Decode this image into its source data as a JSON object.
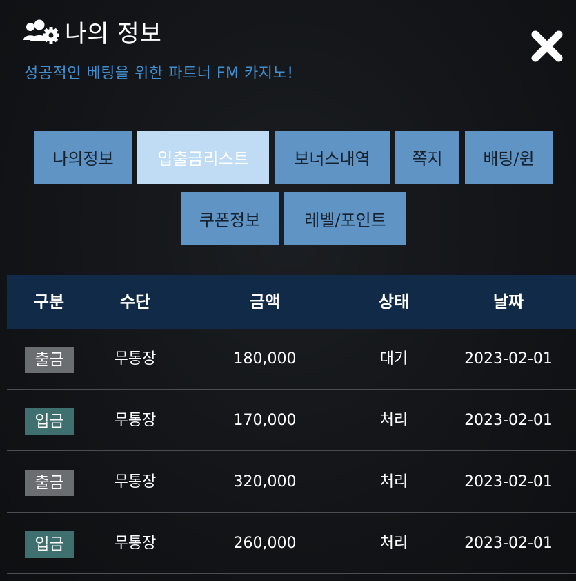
{
  "header": {
    "title": "나의 정보",
    "subtitle": "성공적인 베팅을 위한 파트너 FM 카지노!",
    "title_icon": "users-gear-icon",
    "close_icon": "close-icon"
  },
  "tabs": [
    {
      "label": "나의정보",
      "active": false
    },
    {
      "label": "입출금리스트",
      "active": true
    },
    {
      "label": "보너스내역",
      "active": false
    },
    {
      "label": "쪽지",
      "active": false
    },
    {
      "label": "배팅/윈",
      "active": false
    },
    {
      "label": "쿠폰정보",
      "active": false
    },
    {
      "label": "레벨/포인트",
      "active": false
    }
  ],
  "table": {
    "columns": [
      "구분",
      "수단",
      "금액",
      "상태",
      "날짜"
    ],
    "rows": [
      {
        "type": "출금",
        "kind": "withdraw",
        "method": "무통장",
        "amount": "180,000",
        "status": "대기",
        "date": "2023-02-01"
      },
      {
        "type": "입금",
        "kind": "deposit",
        "method": "무통장",
        "amount": "170,000",
        "status": "처리",
        "date": "2023-02-01"
      },
      {
        "type": "출금",
        "kind": "withdraw",
        "method": "무통장",
        "amount": "320,000",
        "status": "처리",
        "date": "2023-02-01"
      },
      {
        "type": "입금",
        "kind": "deposit",
        "method": "무통장",
        "amount": "260,000",
        "status": "처리",
        "date": "2023-02-01"
      }
    ]
  },
  "colors": {
    "accent_subtitle": "#3f8fd1",
    "tab_bg": "#5f94c4",
    "tab_active_bg": "#bfdcf4",
    "table_header_bg": "#112a47",
    "badge_withdraw": "#6b6e70",
    "badge_deposit": "#3f7070"
  }
}
